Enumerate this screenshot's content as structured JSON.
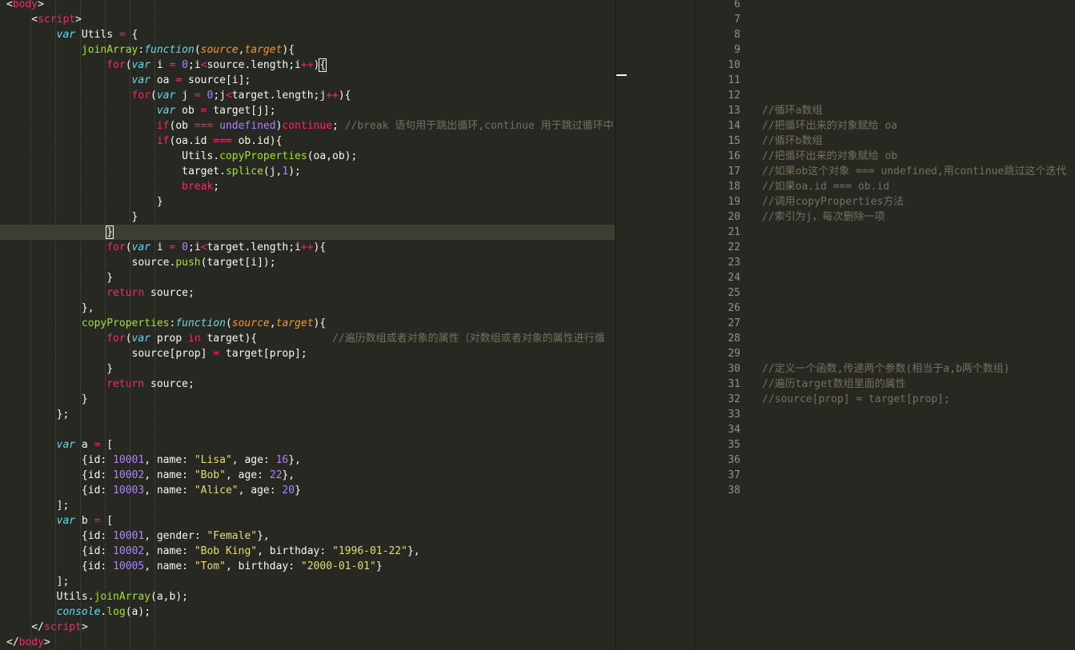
{
  "editor": {
    "left_code_lines": [
      [
        [
          "t-w",
          "<"
        ],
        [
          "t-p",
          "body"
        ],
        [
          "t-w",
          ">"
        ]
      ],
      [
        [
          "t-w",
          "    <"
        ],
        [
          "t-p",
          "script"
        ],
        [
          "t-w",
          ">"
        ]
      ],
      [
        [
          "t-w",
          "        "
        ],
        [
          "t-b t-i",
          "var"
        ],
        [
          "t-w",
          " Utils "
        ],
        [
          "t-p",
          "="
        ],
        [
          "t-w",
          " {"
        ]
      ],
      [
        [
          "t-w",
          "            "
        ],
        [
          "t-g",
          "joinArray"
        ],
        [
          "t-w",
          ":"
        ],
        [
          "t-b t-i",
          "function"
        ],
        [
          "t-w",
          "("
        ],
        [
          "t-o t-i",
          "source"
        ],
        [
          "t-w",
          ","
        ],
        [
          "t-o t-i",
          "target"
        ],
        [
          "t-w",
          "){"
        ]
      ],
      [
        [
          "t-w",
          "                "
        ],
        [
          "t-p",
          "for"
        ],
        [
          "t-w",
          "("
        ],
        [
          "t-b t-i",
          "var"
        ],
        [
          "t-w",
          " i "
        ],
        [
          "t-p",
          "="
        ],
        [
          "t-w",
          " "
        ],
        [
          "t-n",
          "0"
        ],
        [
          "t-w",
          ";i"
        ],
        [
          "t-p",
          "<"
        ],
        [
          "t-w",
          "source.length;i"
        ],
        [
          "t-p",
          "++"
        ],
        [
          "t-w",
          ")"
        ],
        [
          "t-w bracket-hl",
          "{"
        ]
      ],
      [
        [
          "t-w",
          "                    "
        ],
        [
          "t-b t-i",
          "var"
        ],
        [
          "t-w",
          " oa "
        ],
        [
          "t-p",
          "="
        ],
        [
          "t-w",
          " source[i];"
        ]
      ],
      [
        [
          "t-w",
          "                    "
        ],
        [
          "t-p",
          "for"
        ],
        [
          "t-w",
          "("
        ],
        [
          "t-b t-i",
          "var"
        ],
        [
          "t-w",
          " j "
        ],
        [
          "t-p",
          "="
        ],
        [
          "t-w",
          " "
        ],
        [
          "t-n",
          "0"
        ],
        [
          "t-w",
          ";j"
        ],
        [
          "t-p",
          "<"
        ],
        [
          "t-w",
          "target.length;j"
        ],
        [
          "t-p",
          "++"
        ],
        [
          "t-w",
          "){"
        ]
      ],
      [
        [
          "t-w",
          "                        "
        ],
        [
          "t-b t-i",
          "var"
        ],
        [
          "t-w",
          " ob "
        ],
        [
          "t-p",
          "="
        ],
        [
          "t-w",
          " target[j];"
        ]
      ],
      [
        [
          "t-w",
          "                        "
        ],
        [
          "t-p",
          "if"
        ],
        [
          "t-w",
          "(ob "
        ],
        [
          "t-p",
          "==="
        ],
        [
          "t-w",
          " "
        ],
        [
          "t-n",
          "undefined"
        ],
        [
          "t-w",
          ")"
        ],
        [
          "t-p",
          "continue"
        ],
        [
          "t-w",
          "; "
        ],
        [
          "t-c",
          "//break 语句用于跳出循环,continue 用于跳过循环中"
        ]
      ],
      [
        [
          "t-w",
          "                        "
        ],
        [
          "t-p",
          "if"
        ],
        [
          "t-w",
          "(oa.id "
        ],
        [
          "t-p",
          "==="
        ],
        [
          "t-w",
          " ob.id){"
        ]
      ],
      [
        [
          "t-w",
          "                            Utils."
        ],
        [
          "t-g",
          "copyProperties"
        ],
        [
          "t-w",
          "(oa,ob);"
        ]
      ],
      [
        [
          "t-w",
          "                            target."
        ],
        [
          "t-g",
          "splice"
        ],
        [
          "t-w",
          "(j,"
        ],
        [
          "t-n",
          "1"
        ],
        [
          "t-w",
          ");"
        ]
      ],
      [
        [
          "t-w",
          "                            "
        ],
        [
          "t-p",
          "break"
        ],
        [
          "t-w",
          ";"
        ]
      ],
      [
        [
          "t-w",
          "                        }"
        ]
      ],
      [
        [
          "t-w",
          "                    }"
        ]
      ],
      [
        [
          "t-w",
          "                "
        ],
        [
          "t-w bracket-hl",
          "}"
        ]
      ],
      [
        [
          "t-w",
          "                "
        ],
        [
          "t-p",
          "for"
        ],
        [
          "t-w",
          "("
        ],
        [
          "t-b t-i",
          "var"
        ],
        [
          "t-w",
          " i "
        ],
        [
          "t-p",
          "="
        ],
        [
          "t-w",
          " "
        ],
        [
          "t-n",
          "0"
        ],
        [
          "t-w",
          ";i"
        ],
        [
          "t-p",
          "<"
        ],
        [
          "t-w",
          "target.length;i"
        ],
        [
          "t-p",
          "++"
        ],
        [
          "t-w",
          "){"
        ]
      ],
      [
        [
          "t-w",
          "                    source."
        ],
        [
          "t-g",
          "push"
        ],
        [
          "t-w",
          "(target[i]);"
        ]
      ],
      [
        [
          "t-w",
          "                }"
        ]
      ],
      [
        [
          "t-w",
          "                "
        ],
        [
          "t-p",
          "return"
        ],
        [
          "t-w",
          " source;"
        ]
      ],
      [
        [
          "t-w",
          "            },"
        ]
      ],
      [
        [
          "t-w",
          "            "
        ],
        [
          "t-g",
          "copyProperties"
        ],
        [
          "t-w",
          ":"
        ],
        [
          "t-b t-i",
          "function"
        ],
        [
          "t-w",
          "("
        ],
        [
          "t-o t-i",
          "source"
        ],
        [
          "t-w",
          ","
        ],
        [
          "t-o t-i",
          "target"
        ],
        [
          "t-w",
          "){"
        ]
      ],
      [
        [
          "t-w",
          "                "
        ],
        [
          "t-p",
          "for"
        ],
        [
          "t-w",
          "("
        ],
        [
          "t-b t-i",
          "var"
        ],
        [
          "t-w",
          " prop "
        ],
        [
          "t-p",
          "in"
        ],
        [
          "t-w",
          " target){            "
        ],
        [
          "t-c",
          "//遍历数组或者对象的属性（对数组或者对象的属性进行循"
        ]
      ],
      [
        [
          "t-w",
          "                    source[prop] "
        ],
        [
          "t-p",
          "="
        ],
        [
          "t-w",
          " target[prop];"
        ]
      ],
      [
        [
          "t-w",
          "                }"
        ]
      ],
      [
        [
          "t-w",
          "                "
        ],
        [
          "t-p",
          "return"
        ],
        [
          "t-w",
          " source;"
        ]
      ],
      [
        [
          "t-w",
          "            }"
        ]
      ],
      [
        [
          "t-w",
          "        };"
        ]
      ],
      [
        [
          "t-w",
          ""
        ]
      ],
      [
        [
          "t-w",
          "        "
        ],
        [
          "t-b t-i",
          "var"
        ],
        [
          "t-w",
          " a "
        ],
        [
          "t-p",
          "="
        ],
        [
          "t-w",
          " ["
        ]
      ],
      [
        [
          "t-w",
          "            {id: "
        ],
        [
          "t-n",
          "10001"
        ],
        [
          "t-w",
          ", name: "
        ],
        [
          "t-y",
          "\"Lisa\""
        ],
        [
          "t-w",
          ", age: "
        ],
        [
          "t-n",
          "16"
        ],
        [
          "t-w",
          "},"
        ]
      ],
      [
        [
          "t-w",
          "            {id: "
        ],
        [
          "t-n",
          "10002"
        ],
        [
          "t-w",
          ", name: "
        ],
        [
          "t-y",
          "\"Bob\""
        ],
        [
          "t-w",
          ", age: "
        ],
        [
          "t-n",
          "22"
        ],
        [
          "t-w",
          "},"
        ]
      ],
      [
        [
          "t-w",
          "            {id: "
        ],
        [
          "t-n",
          "10003"
        ],
        [
          "t-w",
          ", name: "
        ],
        [
          "t-y",
          "\"Alice\""
        ],
        [
          "t-w",
          ", age: "
        ],
        [
          "t-n",
          "20"
        ],
        [
          "t-w",
          "}"
        ]
      ],
      [
        [
          "t-w",
          "        ];"
        ]
      ],
      [
        [
          "t-w",
          "        "
        ],
        [
          "t-b t-i",
          "var"
        ],
        [
          "t-w",
          " b "
        ],
        [
          "t-p",
          "="
        ],
        [
          "t-w",
          " ["
        ]
      ],
      [
        [
          "t-w",
          "            {id: "
        ],
        [
          "t-n",
          "10001"
        ],
        [
          "t-w",
          ", gender: "
        ],
        [
          "t-y",
          "\"Female\""
        ],
        [
          "t-w",
          "},"
        ]
      ],
      [
        [
          "t-w",
          "            {id: "
        ],
        [
          "t-n",
          "10002"
        ],
        [
          "t-w",
          ", name: "
        ],
        [
          "t-y",
          "\"Bob King\""
        ],
        [
          "t-w",
          ", birthday: "
        ],
        [
          "t-y",
          "\"1996-01-22\""
        ],
        [
          "t-w",
          "},"
        ]
      ],
      [
        [
          "t-w",
          "            {id: "
        ],
        [
          "t-n",
          "10005"
        ],
        [
          "t-w",
          ", name: "
        ],
        [
          "t-y",
          "\"Tom\""
        ],
        [
          "t-w",
          ", birthday: "
        ],
        [
          "t-y",
          "\"2000-01-01\""
        ],
        [
          "t-w",
          "}"
        ]
      ],
      [
        [
          "t-w",
          "        ];"
        ]
      ],
      [
        [
          "t-w",
          "        Utils."
        ],
        [
          "t-g",
          "joinArray"
        ],
        [
          "t-w",
          "(a,b);"
        ]
      ],
      [
        [
          "t-w",
          "        "
        ],
        [
          "t-b t-i",
          "console"
        ],
        [
          "t-w",
          "."
        ],
        [
          "t-g",
          "log"
        ],
        [
          "t-w",
          "(a);"
        ]
      ],
      [
        [
          "t-w",
          "    </"
        ],
        [
          "t-p",
          "script"
        ],
        [
          "t-w",
          ">"
        ]
      ],
      [
        [
          "t-w",
          "</"
        ],
        [
          "t-p",
          "body"
        ],
        [
          "t-w",
          ">"
        ]
      ]
    ],
    "right_line_numbers": [
      "6",
      "7",
      "8",
      "9",
      "10",
      "11",
      "12",
      "13",
      "14",
      "15",
      "16",
      "17",
      "18",
      "19",
      "20",
      "21",
      "22",
      "23",
      "24",
      "25",
      "26",
      "27",
      "28",
      "29",
      "30",
      "31",
      "32",
      "33",
      "34",
      "35",
      "36",
      "37",
      "38"
    ],
    "right_comments": {
      "13": "//循环a数组",
      "14": "//把循环出来的对象赋给 oa",
      "15": "//循环b数组",
      "16": "//把循环出来的对象赋给 ob",
      "17": "//如果ob这个对象 === undefined,用continue跳过这个迭代",
      "18": "//如果oa.id === ob.id",
      "19": "//调用copyProperties方法",
      "20": "//索引为j，每次删除一项",
      "30": "//定义一个函数,传递两个参数(相当于a,b两个数组)",
      "31": "//遍历target数组里面的属性",
      "32": "//source[prop] = target[prop];"
    },
    "active_line_index": 15
  }
}
